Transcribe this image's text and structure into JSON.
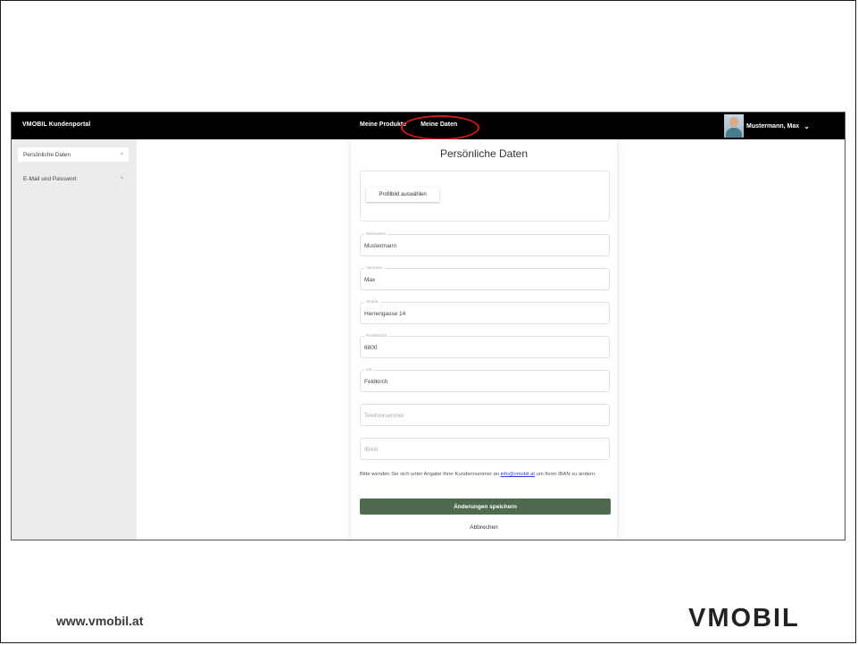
{
  "header": {
    "brand": "VMOBIL Kundenportal",
    "nav": [
      "Meine Produkte",
      "Meine Daten"
    ],
    "user_name": "Mustermann, Max",
    "chevron_icon": "chevron-down-icon",
    "highlight_color": "#d21b1b"
  },
  "sidebar": {
    "items": [
      {
        "label": "Persönliche Daten",
        "arrow": ">"
      },
      {
        "label": "E-Mail und Passwort",
        "arrow": ">"
      }
    ]
  },
  "form": {
    "title": "Persönliche Daten",
    "profile_button": "Profilbild auswählen",
    "fields": [
      {
        "label": "Nachname",
        "value": "Mustermann",
        "placeholder": ""
      },
      {
        "label": "Vorname",
        "value": "Max",
        "placeholder": ""
      },
      {
        "label": "Straße",
        "value": "Herrengasse 14",
        "placeholder": ""
      },
      {
        "label": "Postleitzahl",
        "value": "6800",
        "placeholder": ""
      },
      {
        "label": "Ort",
        "value": "Feldkirch",
        "placeholder": ""
      },
      {
        "label": "",
        "value": "",
        "placeholder": "Telefonnummer"
      },
      {
        "label": "",
        "value": "",
        "placeholder": "IBAN"
      }
    ],
    "info_before": "Bitte wenden Sie sich unter Angabe Ihrer Kundennummer an ",
    "info_email": "info@vmobil.at",
    "info_after": " um Ihren IBAN zu ändern.",
    "save_label": "Änderungen speichern",
    "save_color": "#4f6b4f",
    "cancel_label": "Abbrechen"
  },
  "footer": {
    "url": "www.vmobil.at",
    "logo": "VMOBIL"
  }
}
